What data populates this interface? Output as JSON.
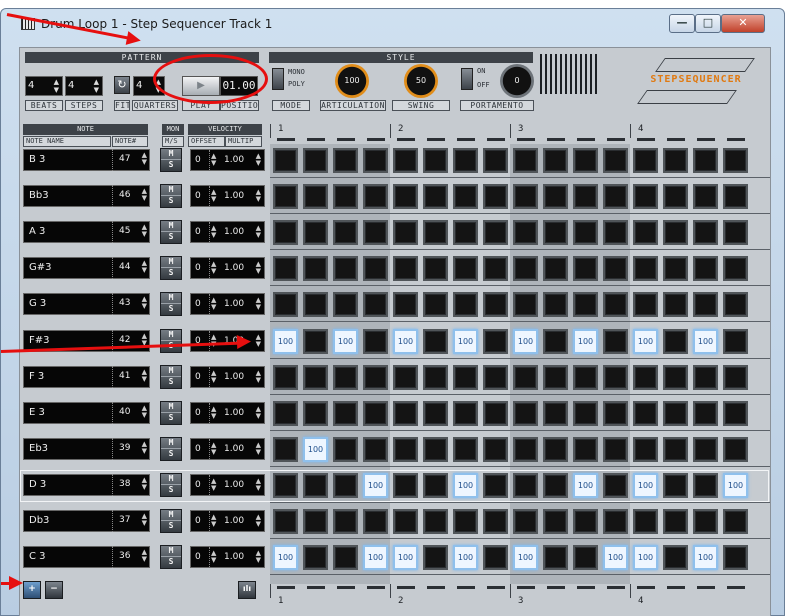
{
  "window": {
    "title": "Drum Loop 1 - Step Sequencer Track 1",
    "min_glyph": "—",
    "max_glyph": "□",
    "close_glyph": "✕"
  },
  "pattern": {
    "header": "PATTERN",
    "beats_value": "4",
    "steps_value": "4",
    "quarters_value": "4",
    "position_value": "01.00",
    "labels": {
      "beats": "BEATS",
      "steps": "STEPS",
      "fit": "FIT",
      "quarters": "QUARTERS",
      "play": "PLAY",
      "position": "POSITION"
    },
    "play_glyph": "▶",
    "loop_glyph": "↻"
  },
  "style": {
    "header": "STYLE",
    "mono_label": "MONO",
    "poly_label": "POLY",
    "mode_label": "MODE",
    "articulation_value": "100",
    "articulation_label": "ARTICULATION",
    "swing_value": "50",
    "swing_label": "SWING",
    "on_label": "ON",
    "off_label": "OFF",
    "portamento_value": "0",
    "portamento_label": "PORTAMENTO"
  },
  "logo": {
    "text": "STEPSEQUENCER"
  },
  "columns": {
    "note": "NOTE",
    "mon": "MON",
    "velocity": "VELOCITY",
    "note_name": "NOTE NAME",
    "note_num": "NOTE#",
    "ms": "M/S",
    "offset": "OFFSET",
    "multip": "MULTIP"
  },
  "ruler": {
    "beats": [
      "1",
      "2",
      "3",
      "4"
    ]
  },
  "ms_glyph_m": "M",
  "ms_glyph_s": "S",
  "spin_glyph": "▲▼",
  "rows": [
    {
      "name": "B 3",
      "num": "47",
      "offset": "0",
      "mult": "1.00",
      "steps": [
        0,
        0,
        0,
        0,
        0,
        0,
        0,
        0,
        0,
        0,
        0,
        0,
        0,
        0,
        0,
        0
      ]
    },
    {
      "name": "Bb3",
      "num": "46",
      "offset": "0",
      "mult": "1.00",
      "steps": [
        0,
        0,
        0,
        0,
        0,
        0,
        0,
        0,
        0,
        0,
        0,
        0,
        0,
        0,
        0,
        0
      ]
    },
    {
      "name": "A 3",
      "num": "45",
      "offset": "0",
      "mult": "1.00",
      "steps": [
        0,
        0,
        0,
        0,
        0,
        0,
        0,
        0,
        0,
        0,
        0,
        0,
        0,
        0,
        0,
        0
      ]
    },
    {
      "name": "G#3",
      "num": "44",
      "offset": "0",
      "mult": "1.00",
      "steps": [
        0,
        0,
        0,
        0,
        0,
        0,
        0,
        0,
        0,
        0,
        0,
        0,
        0,
        0,
        0,
        0
      ]
    },
    {
      "name": "G 3",
      "num": "43",
      "offset": "0",
      "mult": "1.00",
      "steps": [
        0,
        0,
        0,
        0,
        0,
        0,
        0,
        0,
        0,
        0,
        0,
        0,
        0,
        0,
        0,
        0
      ]
    },
    {
      "name": "F#3",
      "num": "42",
      "offset": "0",
      "mult": "1.00",
      "steps": [
        1,
        0,
        1,
        0,
        1,
        0,
        1,
        0,
        1,
        0,
        1,
        0,
        1,
        0,
        1,
        0
      ]
    },
    {
      "name": "F 3",
      "num": "41",
      "offset": "0",
      "mult": "1.00",
      "steps": [
        0,
        0,
        0,
        0,
        0,
        0,
        0,
        0,
        0,
        0,
        0,
        0,
        0,
        0,
        0,
        0
      ]
    },
    {
      "name": "E 3",
      "num": "40",
      "offset": "0",
      "mult": "1.00",
      "steps": [
        0,
        0,
        0,
        0,
        0,
        0,
        0,
        0,
        0,
        0,
        0,
        0,
        0,
        0,
        0,
        0
      ]
    },
    {
      "name": "Eb3",
      "num": "39",
      "offset": "0",
      "mult": "1.00",
      "steps": [
        0,
        1,
        0,
        0,
        0,
        0,
        0,
        0,
        0,
        0,
        0,
        0,
        0,
        0,
        0,
        0
      ]
    },
    {
      "name": "D 3",
      "num": "38",
      "offset": "0",
      "mult": "1.00",
      "steps": [
        0,
        0,
        0,
        1,
        0,
        0,
        1,
        0,
        0,
        0,
        1,
        0,
        1,
        0,
        0,
        1
      ]
    },
    {
      "name": "Db3",
      "num": "37",
      "offset": "0",
      "mult": "1.00",
      "steps": [
        0,
        0,
        0,
        0,
        0,
        0,
        0,
        0,
        0,
        0,
        0,
        0,
        0,
        0,
        0,
        0
      ]
    },
    {
      "name": "C 3",
      "num": "36",
      "offset": "0",
      "mult": "1.00",
      "steps": [
        1,
        0,
        0,
        1,
        1,
        0,
        1,
        0,
        1,
        0,
        0,
        1,
        1,
        0,
        1,
        0
      ]
    }
  ],
  "step_on_value": "100",
  "highlighted_row": 9,
  "bottom": {
    "add_glyph": "+",
    "remove_glyph": "−",
    "meter_glyph": "ılı"
  },
  "colors": {
    "accent_orange": "#e08d1a",
    "step_on": "#eef6ff",
    "annotation": "#e60f0f"
  }
}
